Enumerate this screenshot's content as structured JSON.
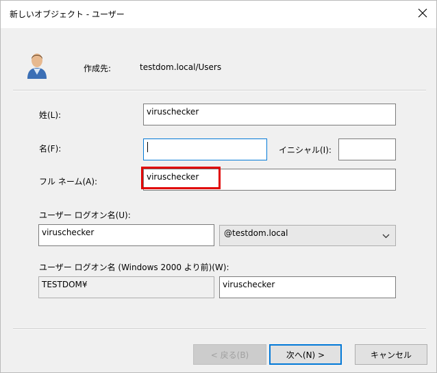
{
  "window": {
    "title": "新しいオブジェクト - ユーザー"
  },
  "header": {
    "create_in_label": "作成先:",
    "create_in_value": "testdom.local/Users"
  },
  "form": {
    "last_name_label": "姓(L):",
    "last_name_value": "viruschecker",
    "first_name_label": "名(F):",
    "first_name_value": "",
    "initials_label": "イニシャル(I):",
    "initials_value": "",
    "full_name_label": "フル ネーム(A):",
    "full_name_value": "viruschecker",
    "logon_name_label": "ユーザー ログオン名(U):",
    "logon_name_value": "viruschecker",
    "domain_value": "@testdom.local",
    "pre2000_label": "ユーザー ログオン名 (Windows 2000 より前)(W):",
    "pre2000_domain_value": "TESTDOM¥",
    "pre2000_name_value": "viruschecker"
  },
  "buttons": {
    "back": "< 戻る(B)",
    "next": "次へ(N) >",
    "cancel": "キャンセル"
  },
  "colors": {
    "highlight": "#e00000",
    "focus_border": "#0078d7"
  }
}
